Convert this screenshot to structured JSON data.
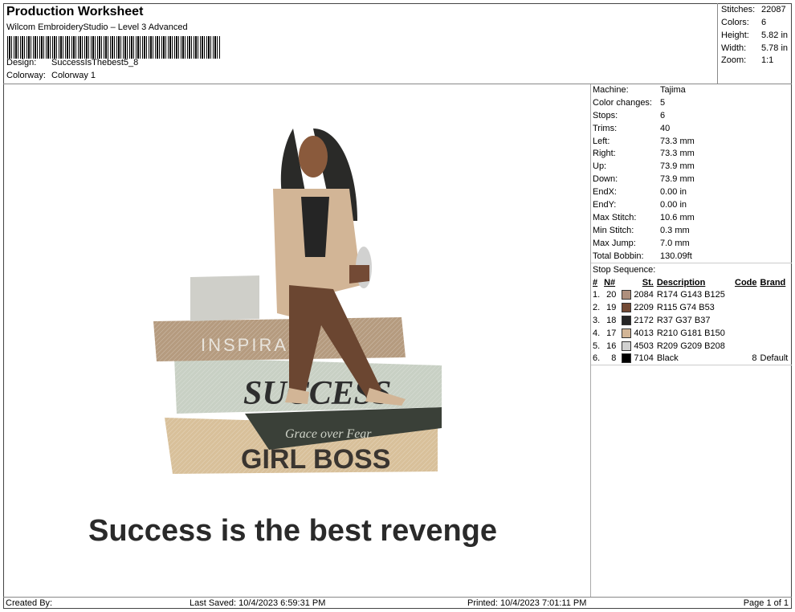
{
  "header": {
    "title": "Production Worksheet",
    "subtitle": "Wilcom EmbroideryStudio – Level 3 Advanced",
    "design_label": "Design:",
    "design_value": "SuccessIsThebest5_8",
    "colorway_label": "Colorway:",
    "colorway_value": "Colorway 1"
  },
  "stats": [
    {
      "label": "Stitches:",
      "value": "22087"
    },
    {
      "label": "Colors:",
      "value": "6"
    },
    {
      "label": "Height:",
      "value": "5.82 in"
    },
    {
      "label": "Width:",
      "value": "5.78 in"
    },
    {
      "label": "Zoom:",
      "value": "1:1"
    }
  ],
  "machine_info": [
    {
      "label": "Machine:",
      "value": "Tajima"
    },
    {
      "label": "Color changes:",
      "value": "5"
    },
    {
      "label": "Stops:",
      "value": "6"
    },
    {
      "label": "Trims:",
      "value": "40"
    },
    {
      "label": "Left:",
      "value": "73.3 mm"
    },
    {
      "label": "Right:",
      "value": "73.3 mm"
    },
    {
      "label": "Up:",
      "value": "73.9 mm"
    },
    {
      "label": "Down:",
      "value": "73.9 mm"
    },
    {
      "label": "EndX:",
      "value": "0.00 in"
    },
    {
      "label": "EndY:",
      "value": "0.00 in"
    },
    {
      "label": "Max Stitch:",
      "value": "10.6 mm"
    },
    {
      "label": "Min Stitch:",
      "value": "0.3 mm"
    },
    {
      "label": "Max Jump:",
      "value": "7.0 mm"
    },
    {
      "label": "Total Bobbin:",
      "value": "130.09ft"
    }
  ],
  "stop_sequence": {
    "title": "Stop Sequence:",
    "columns": [
      "#",
      "N#",
      "St.",
      "Description",
      "Code",
      "Brand"
    ],
    "rows": [
      {
        "num": "1.",
        "n": "20",
        "color": "#ae8f7d",
        "st": "2084",
        "desc": "R174 G143 B125",
        "code": "",
        "brand": ""
      },
      {
        "num": "2.",
        "n": "19",
        "color": "#734a35",
        "st": "2209",
        "desc": "R115 G74 B53",
        "code": "",
        "brand": ""
      },
      {
        "num": "3.",
        "n": "18",
        "color": "#252525",
        "st": "2172",
        "desc": "R37 G37 B37",
        "code": "",
        "brand": ""
      },
      {
        "num": "4.",
        "n": "17",
        "color": "#d2b596",
        "st": "4013",
        "desc": "R210 G181 B150",
        "code": "",
        "brand": ""
      },
      {
        "num": "5.",
        "n": "16",
        "color": "#d1d1d0",
        "st": "4503",
        "desc": "R209 G209 B208",
        "code": "",
        "brand": ""
      },
      {
        "num": "6.",
        "n": "8",
        "color": "#000000",
        "st": "7104",
        "desc": "Black",
        "code": "8",
        "brand": "Default"
      }
    ]
  },
  "design": {
    "book_top": "INSPIRA    N",
    "book_middle": "SUCCESS",
    "book_strip": "Grace over Fear",
    "book_bottom": "GIRL BOSS",
    "caption": "Success is the best revenge"
  },
  "footer": {
    "created_by": "Created By:",
    "last_saved": "Last Saved: 10/4/2023 6:59:31 PM",
    "printed": "Printed: 10/4/2023 7:01:11 PM",
    "page": "Page 1 of 1"
  }
}
